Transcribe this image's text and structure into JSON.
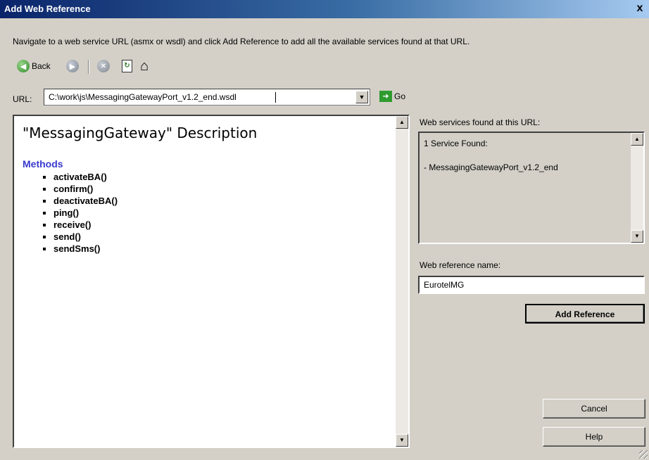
{
  "window": {
    "title": "Add Web Reference",
    "close_glyph": "x"
  },
  "instruction": "Navigate to a web service URL (asmx or wsdl) and click Add Reference to add all the available services found at that URL.",
  "toolbar": {
    "back_label": "Back"
  },
  "url": {
    "label": "URL:",
    "value": "C:\\work\\js\\MessagingGatewayPort_v1.2_end.wsdl",
    "go_label": "Go"
  },
  "browser": {
    "heading": "\"MessagingGateway\" Description",
    "methods_heading": "Methods",
    "methods": [
      "activateBA()",
      "confirm()",
      "deactivateBA()",
      "ping()",
      "receive()",
      "send()",
      "sendSms()"
    ]
  },
  "services_panel": {
    "label": "Web services found at this URL:",
    "count_text": "1 Service Found:",
    "services": [
      "- MessagingGatewayPort_v1.2_end"
    ]
  },
  "reference": {
    "label": "Web reference name:",
    "value": "EurotelMG"
  },
  "buttons": {
    "add_reference": "Add Reference",
    "cancel": "Cancel",
    "help": "Help"
  },
  "icons": [
    "back-icon",
    "forward-icon",
    "stop-icon",
    "refresh-icon",
    "home-icon",
    "go-icon",
    "dropdown-arrow-icon"
  ]
}
